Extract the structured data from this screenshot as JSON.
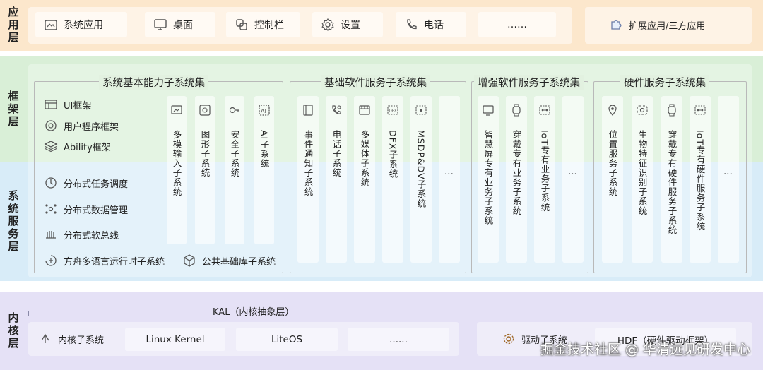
{
  "layers": {
    "app": "应用层",
    "framework": "框架层",
    "system_service": "系统服务层",
    "kernel": "内核层"
  },
  "app_layer": {
    "items": [
      {
        "label": "系统应用",
        "icon": "app-window-icon"
      },
      {
        "label": "桌面",
        "icon": "monitor-icon"
      },
      {
        "label": "控制栏",
        "icon": "control-icon"
      },
      {
        "label": "设置",
        "icon": "gear-icon"
      },
      {
        "label": "电话",
        "icon": "phone-icon"
      },
      {
        "label": "……",
        "icon": ""
      }
    ],
    "extension": {
      "label": "扩展应用/三方应用",
      "icon": "puzzle-icon"
    }
  },
  "basic_capability": {
    "title": "系统基本能力子系统集",
    "framework_items": [
      {
        "label": "UI框架",
        "icon": "ui-icon"
      },
      {
        "label": "用户程序框架",
        "icon": "program-icon"
      },
      {
        "label": "Ability框架",
        "icon": "layers-icon"
      }
    ],
    "service_items": [
      {
        "label": "分布式任务调度",
        "icon": "task-icon"
      },
      {
        "label": "分布式数据管理",
        "icon": "data-icon"
      },
      {
        "label": "分布式软总线",
        "icon": "bus-icon"
      }
    ],
    "bottom_items": [
      {
        "label": "方舟多语言运行时子系统",
        "icon": "ark-icon"
      },
      {
        "label": "公共基础库子系统",
        "icon": "cube-icon"
      }
    ],
    "columns": [
      {
        "label": "多模输入子系统",
        "icon": "input-icon"
      },
      {
        "label": "图形子系统",
        "icon": "graphic-icon"
      },
      {
        "label": "安全子系统",
        "icon": "key-icon"
      },
      {
        "label": "AI子系统",
        "icon": "ai-icon"
      }
    ]
  },
  "basic_software": {
    "title": "基础软件服务子系统集",
    "columns": [
      {
        "label": "事件通知子系统",
        "icon": "notify-icon"
      },
      {
        "label": "电话子系统",
        "icon": "telephony-icon"
      },
      {
        "label": "多媒体子系统",
        "icon": "media-icon"
      },
      {
        "label": "DFX子系统",
        "icon": "dfx-icon"
      },
      {
        "label": "MSDP&DV子系统",
        "icon": "msdp-icon"
      },
      {
        "label": "⋮",
        "icon": ""
      }
    ]
  },
  "enhanced_software": {
    "title": "增强软件服务子系统集",
    "columns": [
      {
        "label": "智慧屏专有业务子系统",
        "icon": "screen-icon"
      },
      {
        "label": "穿戴专有业务子系统",
        "icon": "watch-icon"
      },
      {
        "label": "IoT专有业务子系统",
        "icon": "iot-icon"
      },
      {
        "label": "⋮",
        "icon": ""
      }
    ]
  },
  "hardware": {
    "title": "硬件服务子系统集",
    "columns": [
      {
        "label": "位置服务子系统",
        "icon": "location-icon"
      },
      {
        "label": "生物特征识别子系统",
        "icon": "biometric-icon"
      },
      {
        "label": "穿戴专有硬件服务子系统",
        "icon": "watch-icon"
      },
      {
        "label": "IoT专有硬件服务子系统",
        "icon": "iot-icon"
      },
      {
        "label": "⋮",
        "icon": ""
      }
    ]
  },
  "kernel_layer": {
    "kal": "KAL（内核抽象层）",
    "kernel_subsystem": "内核子系统",
    "kernels": [
      "Linux Kernel",
      "LiteOS",
      "......"
    ],
    "driver_subsystem": "驱动子系统",
    "hdf": "HDF（硬件驱动框架）"
  },
  "watermark": "掘金技术社区 @ 华清远见研发中心"
}
